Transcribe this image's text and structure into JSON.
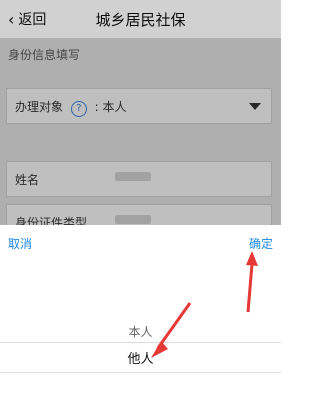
{
  "header": {
    "back_label": "返回",
    "title": "城乡居民社保"
  },
  "form": {
    "section_title": "身份信息填写",
    "fields": [
      {
        "label": "办理对象",
        "help": "?",
        "value": ": 本人"
      },
      {
        "label": "姓名"
      },
      {
        "label": "身份证件类型"
      }
    ]
  },
  "picker": {
    "cancel_label": "取消",
    "confirm_label": "确定",
    "options": [
      "本人",
      "他人"
    ]
  },
  "colors": {
    "accent": "#1e88e5",
    "annotation": "#e53935"
  }
}
